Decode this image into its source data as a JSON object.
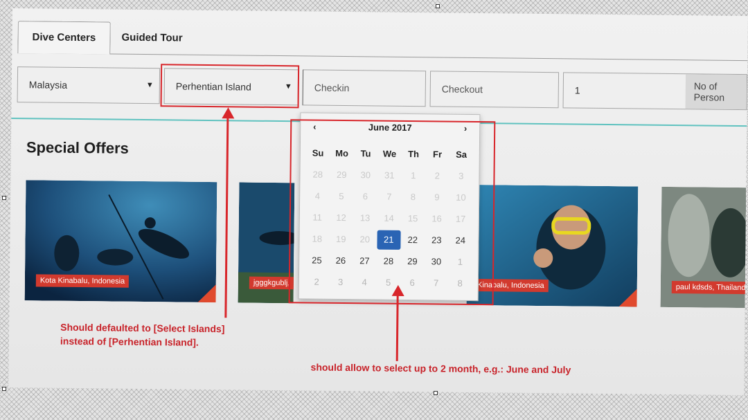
{
  "tabs": [
    {
      "label": "Dive Centers",
      "active": true
    },
    {
      "label": "Guided Tour",
      "active": false
    }
  ],
  "search": {
    "country": "Malaysia",
    "island": "Perhentian Island",
    "checkin_placeholder": "Checkin",
    "checkout_placeholder": "Checkout",
    "persons_value": "1",
    "persons_label": "No of Person"
  },
  "special_offers": {
    "title": "Special Offers",
    "items": [
      {
        "label": "Kota Kinabalu, Indonesia"
      },
      {
        "label": "jgggkgublj,"
      },
      {
        "label": "a Kinabalu, Indonesia"
      },
      {
        "label": "paul kdsds, Thailand"
      }
    ]
  },
  "datepicker": {
    "month_label": "June 2017",
    "prev": "‹",
    "next": "›",
    "weekdays": [
      "Su",
      "Mo",
      "Tu",
      "We",
      "Th",
      "Fr",
      "Sa"
    ],
    "selected": "21",
    "rows": [
      [
        {
          "d": "28",
          "s": "faded"
        },
        {
          "d": "29",
          "s": "faded"
        },
        {
          "d": "30",
          "s": "faded"
        },
        {
          "d": "31",
          "s": "faded"
        },
        {
          "d": "1",
          "s": "faded"
        },
        {
          "d": "2",
          "s": "faded"
        },
        {
          "d": "3",
          "s": "faded"
        }
      ],
      [
        {
          "d": "4",
          "s": "faded"
        },
        {
          "d": "5",
          "s": "faded"
        },
        {
          "d": "6",
          "s": "faded"
        },
        {
          "d": "7",
          "s": "faded"
        },
        {
          "d": "8",
          "s": "faded"
        },
        {
          "d": "9",
          "s": "faded"
        },
        {
          "d": "10",
          "s": "faded"
        }
      ],
      [
        {
          "d": "11",
          "s": "faded"
        },
        {
          "d": "12",
          "s": "faded"
        },
        {
          "d": "13",
          "s": "faded"
        },
        {
          "d": "14",
          "s": "faded"
        },
        {
          "d": "15",
          "s": "faded"
        },
        {
          "d": "16",
          "s": "faded"
        },
        {
          "d": "17",
          "s": "faded"
        }
      ],
      [
        {
          "d": "18",
          "s": "faded"
        },
        {
          "d": "19",
          "s": "faded"
        },
        {
          "d": "20",
          "s": "faded"
        },
        {
          "d": "21",
          "s": "active"
        },
        {
          "d": "22",
          "s": "normal"
        },
        {
          "d": "23",
          "s": "normal"
        },
        {
          "d": "24",
          "s": "normal"
        }
      ],
      [
        {
          "d": "25",
          "s": "normal"
        },
        {
          "d": "26",
          "s": "normal"
        },
        {
          "d": "27",
          "s": "normal"
        },
        {
          "d": "28",
          "s": "normal"
        },
        {
          "d": "29",
          "s": "normal"
        },
        {
          "d": "30",
          "s": "normal"
        },
        {
          "d": "1",
          "s": "other"
        }
      ],
      [
        {
          "d": "2",
          "s": "other"
        },
        {
          "d": "3",
          "s": "other"
        },
        {
          "d": "4",
          "s": "other"
        },
        {
          "d": "5",
          "s": "other"
        },
        {
          "d": "6",
          "s": "other"
        },
        {
          "d": "7",
          "s": "other"
        },
        {
          "d": "8",
          "s": "other"
        }
      ]
    ]
  },
  "annotations": {
    "island_note_line1": "Should defaulted to [Select Islands]",
    "island_note_line2": "instead of [Perhentian Island].",
    "calendar_note": "should allow to select up to 2 month, e.g.: June and July",
    "color": "#d8262b"
  },
  "icons": {
    "dropdown": "caret-down-icon",
    "prev": "chevron-left-icon",
    "next": "chevron-right-icon"
  },
  "colors": {
    "accent_teal": "#5fc2bf",
    "label_red": "#d23a2e",
    "selected_blue": "#2a64b4"
  }
}
